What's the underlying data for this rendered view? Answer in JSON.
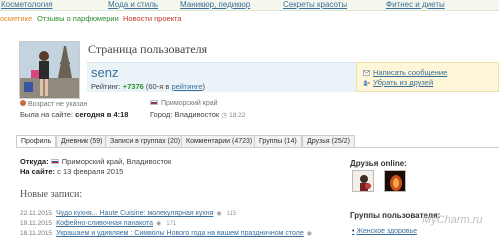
{
  "top_nav": [
    "Косметология",
    "Мода и стиль",
    "Маникюр, педикюр",
    "Секреты красоты",
    "Фитнес и диеты"
  ],
  "sub_nav": [
    {
      "label": "осметике",
      "color": "#e08a1e"
    },
    {
      "label": "Отзывы о парфюмерии",
      "color": "#2e8b2e"
    },
    {
      "label": "Новости проекта",
      "color": "#c0392b"
    }
  ],
  "profile": {
    "page_title": "Страница пользователя",
    "username": "senz",
    "rating_label": "Рейтинг:",
    "rating_value": "+7376",
    "rating_place": "(60-я в",
    "rating_link": "рейтинге",
    "rating_close": ")",
    "actions": [
      "Написать сообщение",
      "Убрать из друзей"
    ],
    "age": "Возраст не указан",
    "last_seen_label": "Была на сайте:",
    "last_seen_value": "сегодня в 4:18",
    "region": "Приморский край",
    "city_label": "Город:",
    "city_value": "Владивосток",
    "city_time": "18:22"
  },
  "tabs": [
    {
      "label": "Профиль"
    },
    {
      "label": "Дневник (59)"
    },
    {
      "label": "Записи в группах (20)"
    },
    {
      "label": "Комментарии (4723)"
    },
    {
      "label": "Группы (14)"
    },
    {
      "label": "Друзья (25/2)"
    }
  ],
  "content": {
    "from_label": "Откуда:",
    "from_value": "Приморский край, Владивосток",
    "since_label": "На сайте:",
    "since_value": "с 13 февраля 2015",
    "new_entries_title": "Новые записи:",
    "entries": [
      {
        "date": "22.11.2015",
        "title": "Чудо кухня... Haute Cuisine: молекулярная кухня",
        "views": "115"
      },
      {
        "date": "19.11.2015",
        "title": "Кофейно-сливочная панакота",
        "views": "171"
      },
      {
        "date": "18.11.2015",
        "title": "Украшаем и удивляем : Символы Нового года на вашем праздничном столе",
        "views": ""
      }
    ],
    "friends_title": "Друзья online:",
    "groups_title": "Группы пользователя:",
    "group_item": "Женское здоровье"
  },
  "watermark": "MyCharm.ru",
  "colors": {
    "link": "#3a6f9c",
    "rating": "#2e8b2e",
    "action_bg": "#fdf6d8",
    "userbar_bg": "#eaf3f8"
  }
}
